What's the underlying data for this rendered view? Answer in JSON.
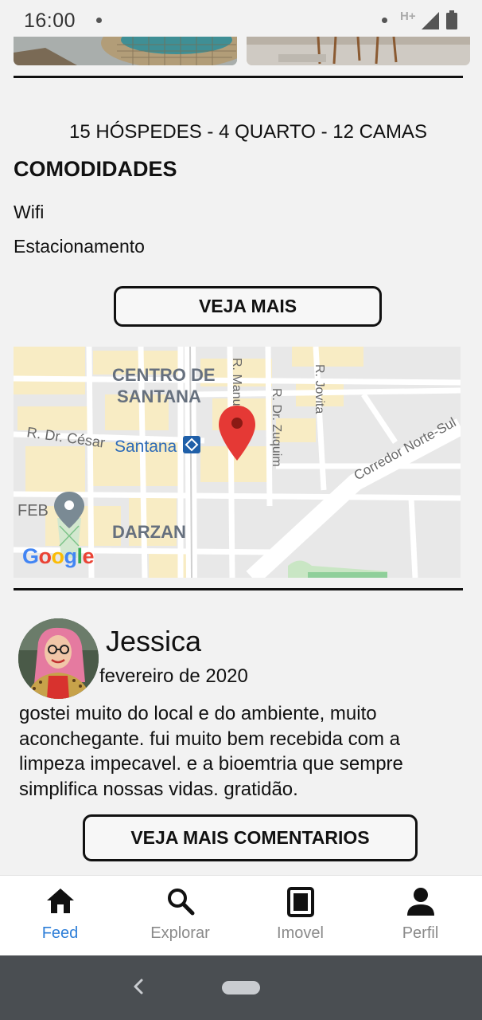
{
  "status_bar": {
    "time": "16:00",
    "network": "H+",
    "icons": [
      "notification-dot-icon",
      "signal-icon",
      "battery-icon"
    ]
  },
  "listing": {
    "specs": "15 HÓSPEDES - 4 QUARTO - 12 CAMAS",
    "amenities_title": "COMODIDADES",
    "amenities": [
      "Wifi",
      "Estacionamento"
    ],
    "more_button": "VEJA MAIS"
  },
  "map": {
    "labels": {
      "centro_line1": "CENTRO DE",
      "centro_line2": "SANTANA",
      "santana": "Santana",
      "rdrcesar": "R. Dr. César",
      "feb": "FEB",
      "darzan": "DARZAN",
      "jovita": "R. Jovita",
      "zuquim": "R. Dr. Zuquim",
      "freire": "R. Manuel Freire",
      "corredor": "Corredor Norte-Sul"
    },
    "google_logo": "Google",
    "pin_color": "#e53935"
  },
  "review": {
    "name": "Jessica",
    "date": "fevereiro de 2020",
    "text": "gostei muito do local e do ambiente, muito aconchegante. fui muito bem recebida com a limpeza impecavel. e a bioemtria que sempre simplifica nossas vidas. gratidão.",
    "more_comments_button": "VEJA MAIS COMENTARIOS"
  },
  "bottom_nav": {
    "items": [
      {
        "label": "Feed",
        "icon": "home-icon",
        "active": true
      },
      {
        "label": "Explorar",
        "icon": "search-icon",
        "active": false
      },
      {
        "label": "Imovel",
        "icon": "building-icon",
        "active": false
      },
      {
        "label": "Perfil",
        "icon": "person-icon",
        "active": false
      }
    ],
    "active_color": "#2f7fd8",
    "inactive_color": "#8a8a8a"
  }
}
